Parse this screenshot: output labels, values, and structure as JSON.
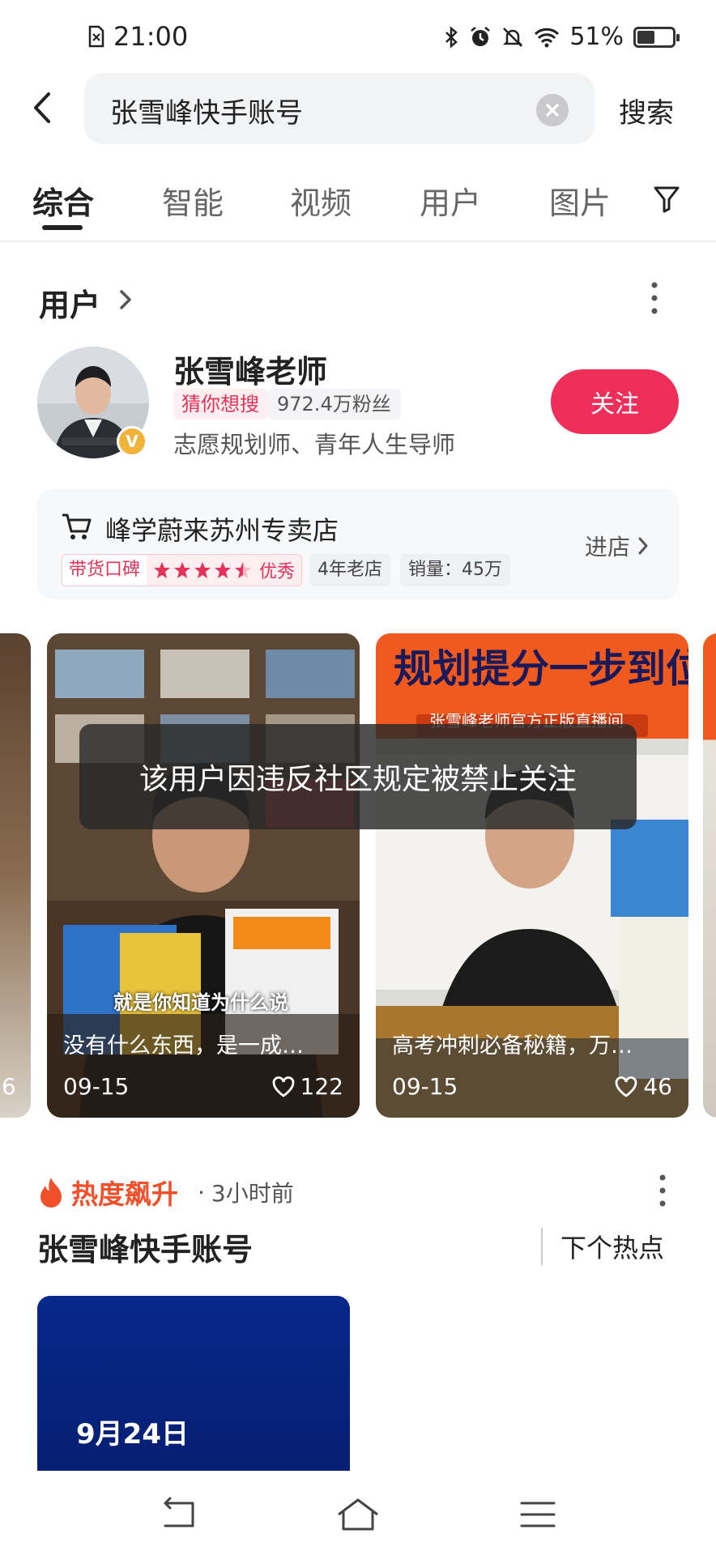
{
  "status_bar": {
    "time": "21:00",
    "battery": "51%",
    "battery_level": 0.51
  },
  "search": {
    "query": "张雪峰快手账号",
    "button_label": "搜索"
  },
  "tabs": [
    {
      "label": "综合",
      "active": true
    },
    {
      "label": "智能"
    },
    {
      "label": "视频"
    },
    {
      "label": "用户"
    },
    {
      "label": "图片"
    }
  ],
  "users_section": {
    "title": "用户",
    "user": {
      "name": "张雪峰老师",
      "tag": "猜你想搜",
      "followers": "972.4万粉丝",
      "description": "志愿规划师、青年人生导师",
      "verified_badge": "V",
      "follow_label": "关注"
    }
  },
  "store": {
    "name": "峰学蔚来苏州专卖店",
    "enter_label": "进店",
    "rating_label": "带货口碑",
    "rating_stars": 4.5,
    "rating_text": "优秀",
    "years": "4年老店",
    "sales": "销量：45万"
  },
  "videos": [
    {
      "caption": "没有什么东西，是一成…",
      "subtitle_in_frame": "就是你知道为什么说",
      "date": "09-15",
      "likes": "122"
    },
    {
      "caption": "高考冲刺必备秘籍，万…",
      "banner_line1": "规划提分一步到位",
      "banner_line2": "张雪峰老师官方正版直播间",
      "date": "09-15",
      "likes": "46"
    }
  ],
  "left_partial_card": {
    "date_fragment": "6"
  },
  "notice": "该用户因违反社区规定被禁止关注",
  "trending": {
    "label": "热度飙升",
    "separator": "·",
    "time": "3小时前",
    "query": "张雪峰快手账号",
    "next_label": "下个热点",
    "news_date": "9月24日"
  },
  "colors": {
    "accent_red": "#f02e5a",
    "hot_orange": "#f0502a",
    "news_blue": "#07278a"
  }
}
